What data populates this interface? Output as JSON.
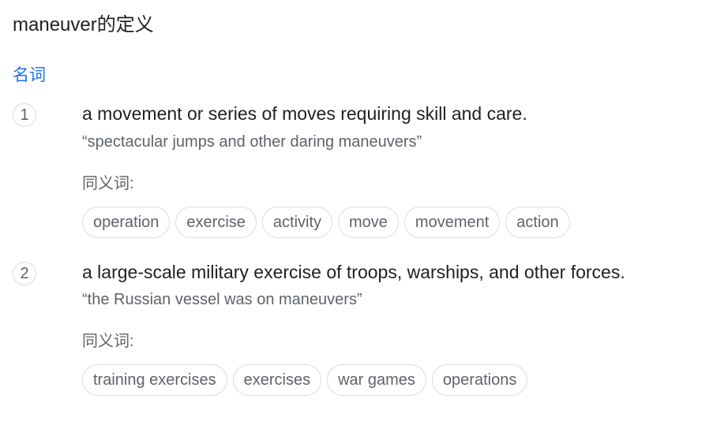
{
  "title": "maneuver的定义",
  "part_of_speech": "名词",
  "synonyms_label": "同义词:",
  "senses": [
    {
      "number": "1",
      "definition": "a movement or series of moves requiring skill and care.",
      "example": "“spectacular jumps and other daring maneuvers”",
      "synonyms": [
        "operation",
        "exercise",
        "activity",
        "move",
        "movement",
        "action"
      ]
    },
    {
      "number": "2",
      "definition": "a large-scale military exercise of troops, warships, and other forces.",
      "example": "“the Russian vessel was on maneuvers”",
      "synonyms": [
        "training exercises",
        "exercises",
        "war games",
        "operations"
      ]
    }
  ]
}
